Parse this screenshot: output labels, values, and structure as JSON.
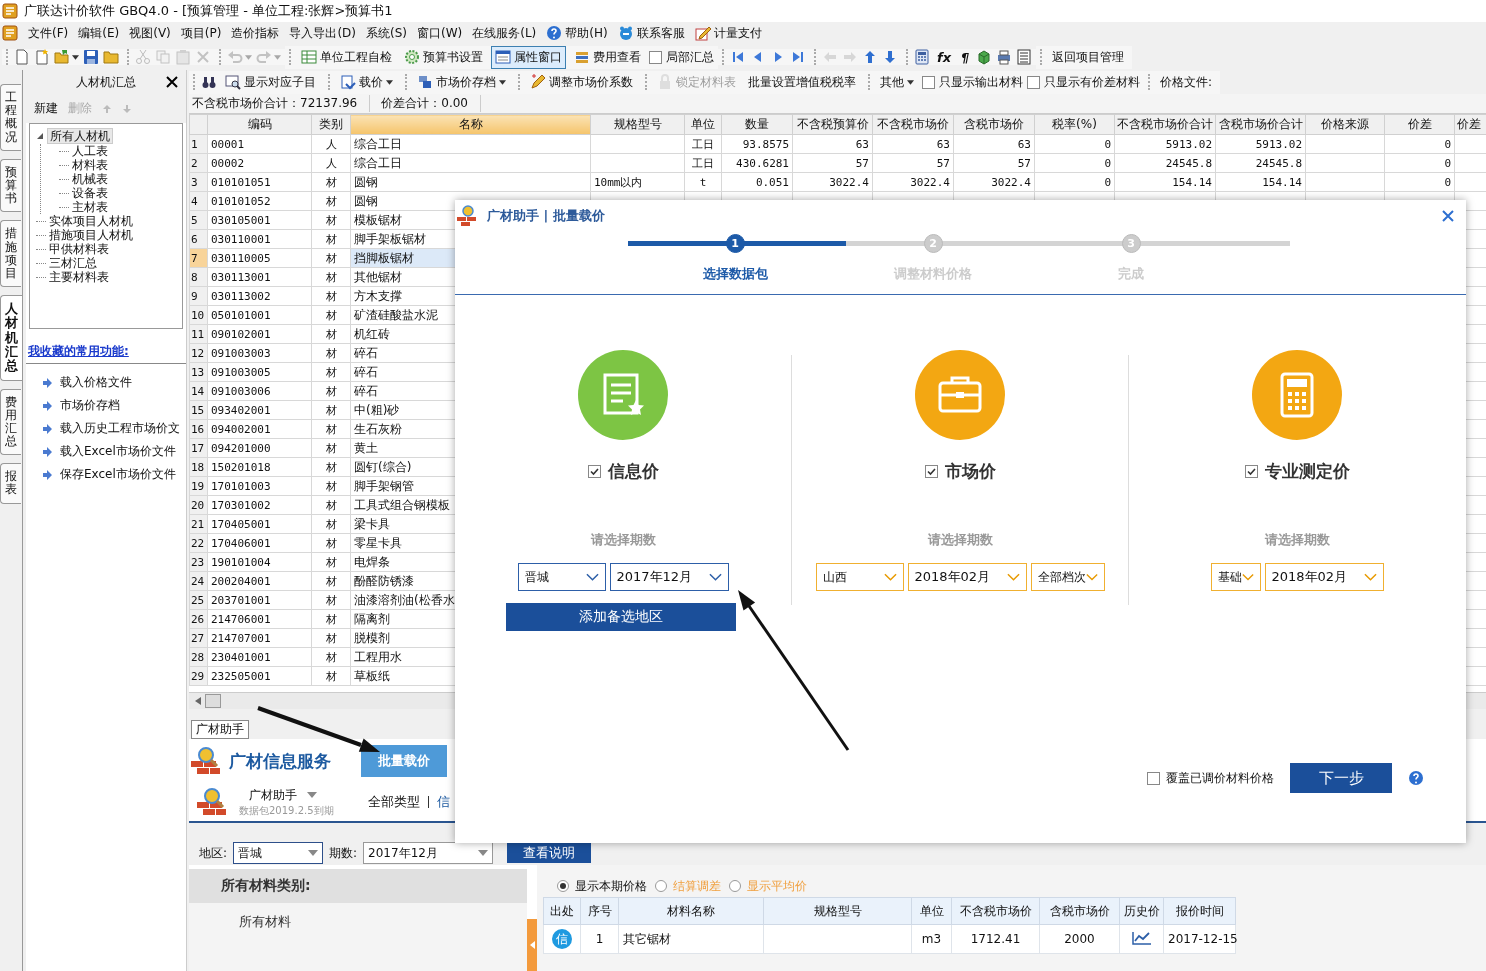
{
  "window": {
    "title": "广联达计价软件 GBQ4.0 - [预算管理 - 单位工程:张辉>预算书1"
  },
  "menu": [
    {
      "label": "文件(F)"
    },
    {
      "label": "编辑(E)"
    },
    {
      "label": "视图(V)"
    },
    {
      "label": "项目(P)"
    },
    {
      "label": "造价指标"
    },
    {
      "label": "导入导出(D)"
    },
    {
      "label": "系统(S)"
    },
    {
      "label": "窗口(W)"
    },
    {
      "label": "在线服务(L)"
    },
    {
      "label": "帮助(H)"
    },
    {
      "label": "联系客服"
    },
    {
      "label": "计量支付"
    }
  ],
  "toolbar": {
    "groups": [
      {
        "items": [
          {
            "kind": "icon",
            "disabled": false
          },
          {
            "kind": "icon",
            "disabled": false
          },
          {
            "kind": "icon-menu",
            "disabled": false
          },
          {
            "kind": "icon",
            "disabled": false
          },
          {
            "kind": "icon",
            "disabled": false
          }
        ]
      },
      {
        "items": [
          {
            "kind": "icon",
            "disabled": true
          },
          {
            "kind": "icon",
            "disabled": true
          },
          {
            "kind": "icon",
            "disabled": true
          },
          {
            "kind": "icon",
            "disabled": true
          }
        ]
      },
      {
        "items": [
          {
            "kind": "icon-menu",
            "disabled": true
          },
          {
            "kind": "icon-menu",
            "disabled": true
          }
        ]
      },
      {
        "items": [
          {
            "kind": "button",
            "label": "单位工程自检",
            "disabled": false
          },
          {
            "kind": "button",
            "label": "预算书设置",
            "disabled": false
          },
          {
            "kind": "toggle",
            "label": "属性窗口",
            "selected": true,
            "disabled": false
          },
          {
            "kind": "button",
            "label": "费用查看",
            "disabled": false
          },
          {
            "kind": "checkbox",
            "label": "局部汇总",
            "checked": false,
            "disabled": false
          }
        ]
      },
      {
        "items": [
          {
            "kind": "icon",
            "disabled": false
          },
          {
            "kind": "icon",
            "disabled": false
          },
          {
            "kind": "icon",
            "disabled": false
          },
          {
            "kind": "icon",
            "disabled": false
          }
        ]
      },
      {
        "items": [
          {
            "kind": "icon",
            "disabled": true
          },
          {
            "kind": "icon",
            "disabled": true
          },
          {
            "kind": "icon",
            "disabled": false
          },
          {
            "kind": "icon",
            "disabled": false
          }
        ]
      },
      {
        "items": [
          {
            "kind": "icon",
            "disabled": false
          },
          {
            "kind": "glyph",
            "label": "fx",
            "disabled": false
          },
          {
            "kind": "glyph",
            "label": "¶",
            "disabled": false
          },
          {
            "kind": "icon",
            "disabled": false
          },
          {
            "kind": "icon",
            "disabled": false
          },
          {
            "kind": "icon",
            "disabled": false
          }
        ]
      },
      {
        "items": [
          {
            "kind": "text",
            "label": "返回项目管理",
            "disabled": false
          }
        ]
      }
    ]
  },
  "side_tabs": [
    {
      "label": "工程概况",
      "selected": false
    },
    {
      "label": "预算书",
      "selected": false
    },
    {
      "label": "措施项目",
      "selected": false
    },
    {
      "label": "人材机汇总",
      "selected": true
    },
    {
      "label": "费用汇总",
      "selected": false
    },
    {
      "label": "报表",
      "selected": false
    }
  ],
  "left_panel": {
    "title": "人材机汇总",
    "actions": [
      {
        "label": "新建",
        "disabled": false
      },
      {
        "label": "删除",
        "disabled": true
      }
    ],
    "tree": [
      {
        "label": "所有人材机",
        "selected": true,
        "expanded": true,
        "children": [
          {
            "label": "人工表",
            "selected": false
          },
          {
            "label": "材料表",
            "selected": false
          },
          {
            "label": "机械表",
            "selected": false
          },
          {
            "label": "设备表",
            "selected": false
          },
          {
            "label": "主材表",
            "selected": false
          }
        ]
      },
      {
        "label": "实体项目人材机",
        "selected": false
      },
      {
        "label": "措施项目人材机",
        "selected": false
      },
      {
        "label": "甲供材料表",
        "selected": false
      },
      {
        "label": "三材汇总",
        "selected": false
      },
      {
        "label": "主要材料表",
        "selected": false
      }
    ],
    "favorites_title": "我收藏的常用功能:",
    "favorites": [
      {
        "label": "载入价格文件"
      },
      {
        "label": "市场价存档"
      },
      {
        "label": "载入历史工程市场价文"
      },
      {
        "label": "载入Excel市场价文件"
      },
      {
        "label": "保存Excel市场价文件"
      }
    ]
  },
  "toolbar2": {
    "groups": [
      {
        "items": [
          {
            "kind": "icon",
            "disabled": false
          },
          {
            "kind": "button",
            "label": "显示对应子目",
            "disabled": false
          }
        ]
      },
      {
        "items": [
          {
            "kind": "button-menu",
            "label": "载价",
            "disabled": false
          }
        ]
      },
      {
        "items": [
          {
            "kind": "button-menu",
            "label": "市场价存档",
            "disabled": false
          }
        ]
      },
      {
        "items": [
          {
            "kind": "button",
            "label": "调整市场价系数",
            "disabled": false
          }
        ]
      },
      {
        "items": [
          {
            "kind": "button",
            "label": "锁定材料表",
            "disabled": true
          },
          {
            "kind": "text",
            "label": "批量设置增值税税率",
            "disabled": false
          }
        ]
      },
      {
        "items": [
          {
            "kind": "text-menu",
            "label": "其他",
            "disabled": false
          },
          {
            "kind": "checkbox",
            "label": "只显示输出材料",
            "checked": false,
            "disabled": false
          },
          {
            "kind": "checkbox",
            "label": "只显示有价差材料",
            "checked": false,
            "disabled": false
          }
        ]
      },
      {
        "items": [
          {
            "kind": "text",
            "label": "价格文件:",
            "disabled": false
          }
        ]
      }
    ]
  },
  "summary": [
    {
      "label": "不含税市场价合计：72137.96"
    },
    {
      "label": "价差合计：0.00"
    }
  ],
  "table": {
    "columns": [
      {
        "label": "编码",
        "selected": false
      },
      {
        "label": "类别",
        "selected": false
      },
      {
        "label": "名称",
        "selected": true
      },
      {
        "label": "规格型号",
        "selected": false
      },
      {
        "label": "单位",
        "selected": false
      },
      {
        "label": "数量",
        "selected": false
      },
      {
        "label": "不含税预算价",
        "selected": false
      },
      {
        "label": "不含税市场价",
        "selected": false
      },
      {
        "label": "含税市场价",
        "selected": false
      },
      {
        "label": "税率(%)",
        "selected": false
      },
      {
        "label": "不含税市场价合计",
        "selected": false
      },
      {
        "label": "含税市场价合计",
        "selected": false
      },
      {
        "label": "价格来源",
        "selected": false
      },
      {
        "label": "价差",
        "selected": false
      },
      {
        "label": "价差",
        "selected": false
      }
    ],
    "rows": [
      {
        "number": "1",
        "selected": false,
        "code": "00001",
        "type": "人",
        "name": "综合工日",
        "unit": "工日",
        "quantity": "93.8575",
        "budget_price_ex_tax": "63",
        "market_price_ex_tax": "63",
        "market_price_inc_tax": "63",
        "tax_rate": "0",
        "total_ex_tax": "5913.02",
        "total_inc_tax": "5913.02",
        "price_diff": "0"
      },
      {
        "number": "2",
        "selected": false,
        "code": "00002",
        "type": "人",
        "name": "综合工日",
        "unit": "工日",
        "quantity": "430.6281",
        "budget_price_ex_tax": "57",
        "market_price_ex_tax": "57",
        "market_price_inc_tax": "57",
        "tax_rate": "0",
        "total_ex_tax": "24545.8",
        "total_inc_tax": "24545.8",
        "price_diff": "0"
      },
      {
        "number": "3",
        "selected": false,
        "code": "010101051",
        "type": "材",
        "name": "圆钢",
        "spec": "10mm以内",
        "unit": "t",
        "quantity": "0.051",
        "budget_price_ex_tax": "3022.4",
        "market_price_ex_tax": "3022.4",
        "market_price_inc_tax": "3022.4",
        "tax_rate": "0",
        "total_ex_tax": "154.14",
        "total_inc_tax": "154.14",
        "price_diff": "0"
      },
      {
        "number": "4",
        "selected": false,
        "code": "010101052",
        "type": "材",
        "name": "圆钢"
      },
      {
        "number": "5",
        "selected": false,
        "code": "030105001",
        "type": "材",
        "name": "模板锯材"
      },
      {
        "number": "6",
        "selected": false,
        "code": "030110001",
        "type": "材",
        "name": "脚手架板锯材"
      },
      {
        "number": "7",
        "selected": true,
        "code": "030110005",
        "type": "材",
        "name": "挡脚板锯材"
      },
      {
        "number": "8",
        "selected": false,
        "code": "030113001",
        "type": "材",
        "name": "其他锯材"
      },
      {
        "number": "9",
        "selected": false,
        "code": "030113002",
        "type": "材",
        "name": "方木支撑"
      },
      {
        "number": "10",
        "selected": false,
        "code": "050101001",
        "type": "材",
        "name": "矿渣硅酸盐水泥"
      },
      {
        "number": "11",
        "selected": false,
        "code": "090102001",
        "type": "材",
        "name": "机红砖"
      },
      {
        "number": "12",
        "selected": false,
        "code": "091003003",
        "type": "材",
        "name": "碎石"
      },
      {
        "number": "13",
        "selected": false,
        "code": "091003005",
        "type": "材",
        "name": "碎石"
      },
      {
        "number": "14",
        "selected": false,
        "code": "091003006",
        "type": "材",
        "name": "碎石"
      },
      {
        "number": "15",
        "selected": false,
        "code": "093402001",
        "type": "材",
        "name": "中(粗)砂"
      },
      {
        "number": "16",
        "selected": false,
        "code": "094002001",
        "type": "材",
        "name": "生石灰粉"
      },
      {
        "number": "17",
        "selected": false,
        "code": "094201000",
        "type": "材",
        "name": "黄土"
      },
      {
        "number": "18",
        "selected": false,
        "code": "150201018",
        "type": "材",
        "name": "圆钉(综合)"
      },
      {
        "number": "19",
        "selected": false,
        "code": "170101003",
        "type": "材",
        "name": "脚手架钢管"
      },
      {
        "number": "20",
        "selected": false,
        "code": "170301002",
        "type": "材",
        "name": "工具式组合钢模板"
      },
      {
        "number": "21",
        "selected": false,
        "code": "170405001",
        "type": "材",
        "name": "梁卡具"
      },
      {
        "number": "22",
        "selected": false,
        "code": "170406001",
        "type": "材",
        "name": "零星卡具"
      },
      {
        "number": "23",
        "selected": false,
        "code": "190101004",
        "type": "材",
        "name": "电焊条"
      },
      {
        "number": "24",
        "selected": false,
        "code": "200204001",
        "type": "材",
        "name": "酚醛防锈漆"
      },
      {
        "number": "25",
        "selected": false,
        "code": "203701001",
        "type": "材",
        "name": "油漆溶剂油(松香水"
      },
      {
        "number": "26",
        "selected": false,
        "code": "214706001",
        "type": "材",
        "name": "隔离剂"
      },
      {
        "number": "27",
        "selected": false,
        "code": "214707001",
        "type": "材",
        "name": "脱模剂"
      },
      {
        "number": "28",
        "selected": false,
        "code": "230401001",
        "type": "材",
        "name": "工程用水"
      },
      {
        "number": "29",
        "selected": false,
        "code": "232505001",
        "type": "材",
        "name": "草板纸"
      }
    ]
  },
  "bottom_panel": {
    "tab": "广材助手",
    "brand": "广材信息服务",
    "primary_button": "批量载价",
    "account": "广材助手",
    "expiry": "数据包2019.2.5到期",
    "categories": [
      {
        "label": "全部类型"
      },
      {
        "label": "信"
      }
    ],
    "filters": [
      {
        "label": "地区:",
        "value": "晋城"
      },
      {
        "label": "期数:",
        "value": "2017年12月"
      }
    ],
    "help_button": "查看说明",
    "category_title": "所有材料类别:",
    "category_items": [
      {
        "label": "所有材料"
      }
    ],
    "price_modes": [
      {
        "label": "显示本期价格",
        "selected": true
      },
      {
        "label": "结算调差",
        "selected": false
      },
      {
        "label": "显示平均价",
        "selected": false
      }
    ],
    "columns": [
      "出处",
      "序号",
      "材料名称",
      "规格型号",
      "单位",
      "不含税市场价",
      "含税市场价",
      "历史价",
      "报价时间"
    ],
    "rows": [
      {
        "source": "信",
        "number": "1",
        "name": "其它锯材",
        "unit": "m3",
        "price_ex_tax": "1712.41",
        "price_inc_tax": "2000",
        "quoted_at": "2017-12-15"
      }
    ]
  },
  "dialog": {
    "title": "广材助手 | 批量载价",
    "progress": {
      "level": 0.33
    },
    "steps": [
      {
        "number": "1",
        "label": "选择数据包",
        "selected": true
      },
      {
        "number": "2",
        "label": "调整材料价格",
        "selected": false
      },
      {
        "number": "3",
        "label": "完成",
        "selected": false
      }
    ],
    "price_types": [
      {
        "label": "信息价",
        "checked": true,
        "color": "#7dc544",
        "active": true,
        "hint": "请选择期数",
        "selects": [
          "晋城",
          "2017年12月"
        ],
        "button": "添加备选地区"
      },
      {
        "label": "市场价",
        "checked": true,
        "color": "#f3a712",
        "active": false,
        "hint": "请选择期数",
        "selects": [
          "山西",
          "2018年02月",
          "全部档次"
        ]
      },
      {
        "label": "专业测定价",
        "checked": true,
        "color": "#f3a712",
        "active": false,
        "hint": "请选择期数",
        "selects": [
          "基础",
          "2018年02月"
        ]
      }
    ],
    "overwrite": {
      "label": "覆盖已调价材料价格",
      "checked": false
    },
    "next_button": "下一步"
  }
}
